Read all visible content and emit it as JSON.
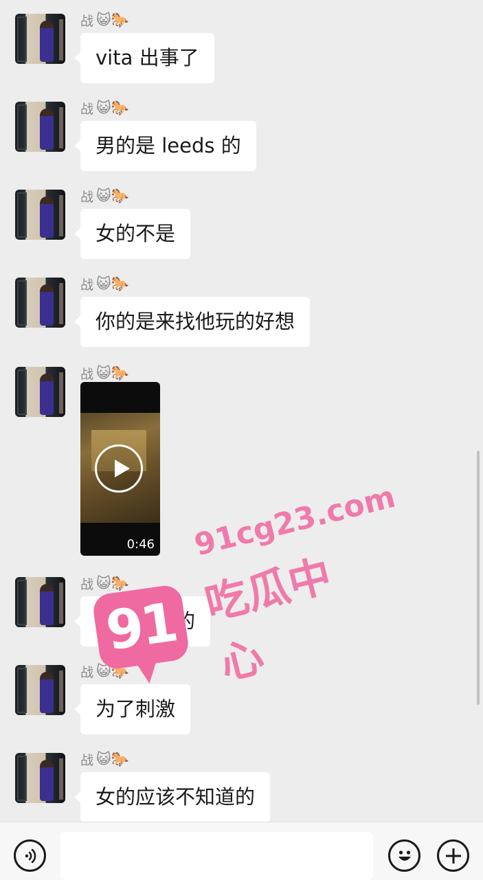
{
  "messages": [
    {
      "sender": "战",
      "emojis": "😺🐎",
      "text": "vita 出事了"
    },
    {
      "sender": "战",
      "emojis": "😺🐎",
      "text": "男的是 leeds 的"
    },
    {
      "sender": "战",
      "emojis": "😺🐎",
      "text": "女的不是"
    },
    {
      "sender": "战",
      "emojis": "😺🐎",
      "text": "你的是来找他玩的好想"
    },
    {
      "sender": "战",
      "emojis": "😺🐎",
      "video_duration": "0:46"
    },
    {
      "sender": "战",
      "emojis": "😺🐎",
      "text": "男的故意的"
    },
    {
      "sender": "战",
      "emojis": "😺🐎",
      "text": "为了刺激"
    },
    {
      "sender": "战",
      "emojis": "😺🐎",
      "text": "女的应该不知道的"
    }
  ],
  "watermark": {
    "logo": "91",
    "url": "91cg23.com",
    "name": "吃瓜中心"
  },
  "composer": {
    "value": "",
    "placeholder": ""
  },
  "icons": {
    "voice": "voice-icon",
    "emoji": "emoji-icon",
    "plus": "plus-icon"
  }
}
